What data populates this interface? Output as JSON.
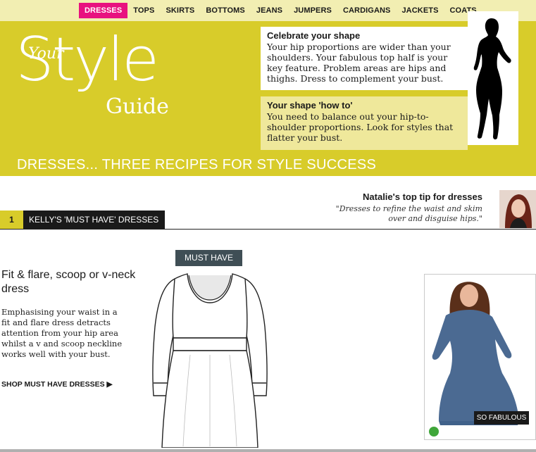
{
  "nav": {
    "items": [
      "DRESSES",
      "TOPS",
      "SKIRTS",
      "BOTTOMS",
      "JEANS",
      "JUMPERS",
      "CARDIGANS",
      "JACKETS",
      "COATS"
    ],
    "active": "DRESSES",
    "bg_color": "#f2eeb2",
    "active_color": "#e8117f"
  },
  "hero": {
    "logo": {
      "your": "Your",
      "style": "Style",
      "guide": "Guide"
    },
    "shape_box": {
      "title": "Celebrate your shape",
      "text": "Your hip proportions are wider than your shoulders. Your fabulous top half is your key feature. Problem areas are hips and thighs. Dress to complement your bust."
    },
    "howto_box": {
      "title": "Your shape 'how to'",
      "text": "You need to balance out your hip-to-shoulder proportions. Look for styles that flatter your bust."
    },
    "banner": "DRESSES... THREE RECIPES FOR STYLE SUCCESS",
    "bg_color": "#d8cc2a"
  },
  "tip": {
    "title": "Natalie's top tip for dresses",
    "quote": "\"Dresses to refine the waist and skim over and disguise hips.\""
  },
  "section": {
    "number": "1",
    "title": "KELLY'S 'MUST HAVE' DRESSES"
  },
  "product": {
    "badge": "MUST HAVE",
    "title": "Fit & flare, scoop or v-neck dress",
    "description": "Emphasising your waist in a fit and flare dress detracts attention from your hip area whilst a v and scoop neckline works well with your bust.",
    "shop_link": "SHOP MUST HAVE DRESSES ▶",
    "photo_label": "SO FABULOUS"
  }
}
